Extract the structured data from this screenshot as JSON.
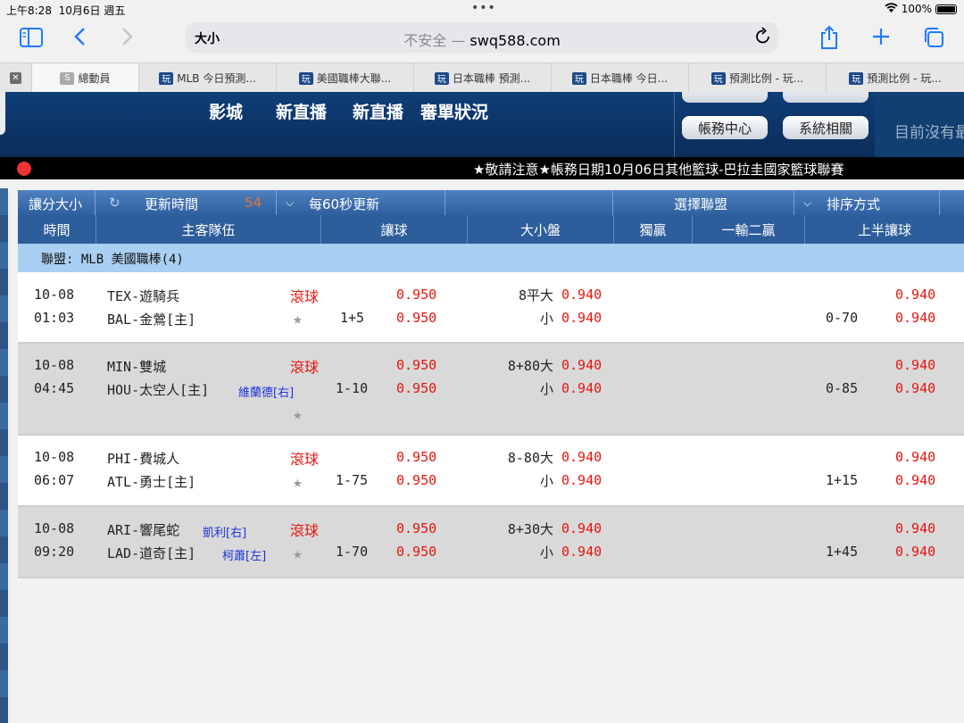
{
  "status": {
    "time": "上午8:28",
    "date": "10月6日 週五",
    "dots": "•••",
    "battery": "100%"
  },
  "nav": {
    "reader": "大小",
    "not_secure": "不安全 —",
    "url": "swq588.com"
  },
  "tabs": [
    {
      "label": "總動員",
      "favicon": "S"
    },
    {
      "label": "MLB 今日預測...",
      "favicon": "玩"
    },
    {
      "label": "美國職棒大聯...",
      "favicon": "玩"
    },
    {
      "label": "日本職棒 預測...",
      "favicon": "玩"
    },
    {
      "label": "日本職棒 今日...",
      "favicon": "玩"
    },
    {
      "label": "預測比例 - 玩...",
      "favicon": "玩"
    },
    {
      "label": "預測比例 - 玩...",
      "favicon": "玩"
    }
  ],
  "menu": [
    "影城",
    "新直播",
    "新直播",
    "審單狀況"
  ],
  "panel": {
    "account": "帳務中心",
    "system": "系統相關",
    "none": "目前沒有最"
  },
  "ticker": "★敬請注意★帳務日期10月06日其他籃球-巴拉圭國家籃球聯賽",
  "toolbar": {
    "size": "讓分大小",
    "update": "更新時間",
    "countdown": "54",
    "auto": "每60秒更新",
    "league": "選擇聯盟",
    "sort": "排序方式"
  },
  "columns": [
    "時間",
    "主客隊伍",
    "讓球",
    "大小盤",
    "獨贏",
    "一輸二贏",
    "上半讓球"
  ],
  "league": "聯盟: MLB 美國職棒(4)",
  "games": [
    {
      "date": "10-08",
      "time": "01:03",
      "away": "TEX-遊騎兵",
      "home": "BAL-金鶯[主]",
      "away_pitcher": "",
      "home_pitcher": "",
      "live": "滾球",
      "line": "1+5",
      "away_odds": "0.950",
      "home_odds": "0.950",
      "total": "8平",
      "over": "大",
      "over_odds": "0.940",
      "under": "小",
      "under_odds": "0.940",
      "h_line": "0-70",
      "h_away": "0.940",
      "h_home": "0.940"
    },
    {
      "date": "10-08",
      "time": "04:45",
      "away": "MIN-雙城",
      "home": "HOU-太空人[主]",
      "away_pitcher": "",
      "home_pitcher": "維蘭德[右]",
      "live": "滾球",
      "line": "1-10",
      "away_odds": "0.950",
      "home_odds": "0.950",
      "total": "8+80",
      "over": "大",
      "over_odds": "0.940",
      "under": "小",
      "under_odds": "0.940",
      "h_line": "0-85",
      "h_away": "0.940",
      "h_home": "0.940"
    },
    {
      "date": "10-08",
      "time": "06:07",
      "away": "PHI-費城人",
      "home": "ATL-勇士[主]",
      "away_pitcher": "",
      "home_pitcher": "",
      "live": "滾球",
      "line": "1-75",
      "away_odds": "0.950",
      "home_odds": "0.950",
      "total": "8-80",
      "over": "大",
      "over_odds": "0.940",
      "under": "小",
      "under_odds": "0.940",
      "h_line": "1+15",
      "h_away": "0.940",
      "h_home": "0.940"
    },
    {
      "date": "10-08",
      "time": "09:20",
      "away": "ARI-響尾蛇",
      "home": "LAD-道奇[主]",
      "away_pitcher": "凱利[右]",
      "home_pitcher": "柯蕭[左]",
      "live": "滾球",
      "line": "1-70",
      "away_odds": "0.950",
      "home_odds": "0.950",
      "total": "8+30",
      "over": "大",
      "over_odds": "0.940",
      "under": "小",
      "under_odds": "0.940",
      "h_line": "1+45",
      "h_away": "0.940",
      "h_home": "0.940"
    }
  ]
}
